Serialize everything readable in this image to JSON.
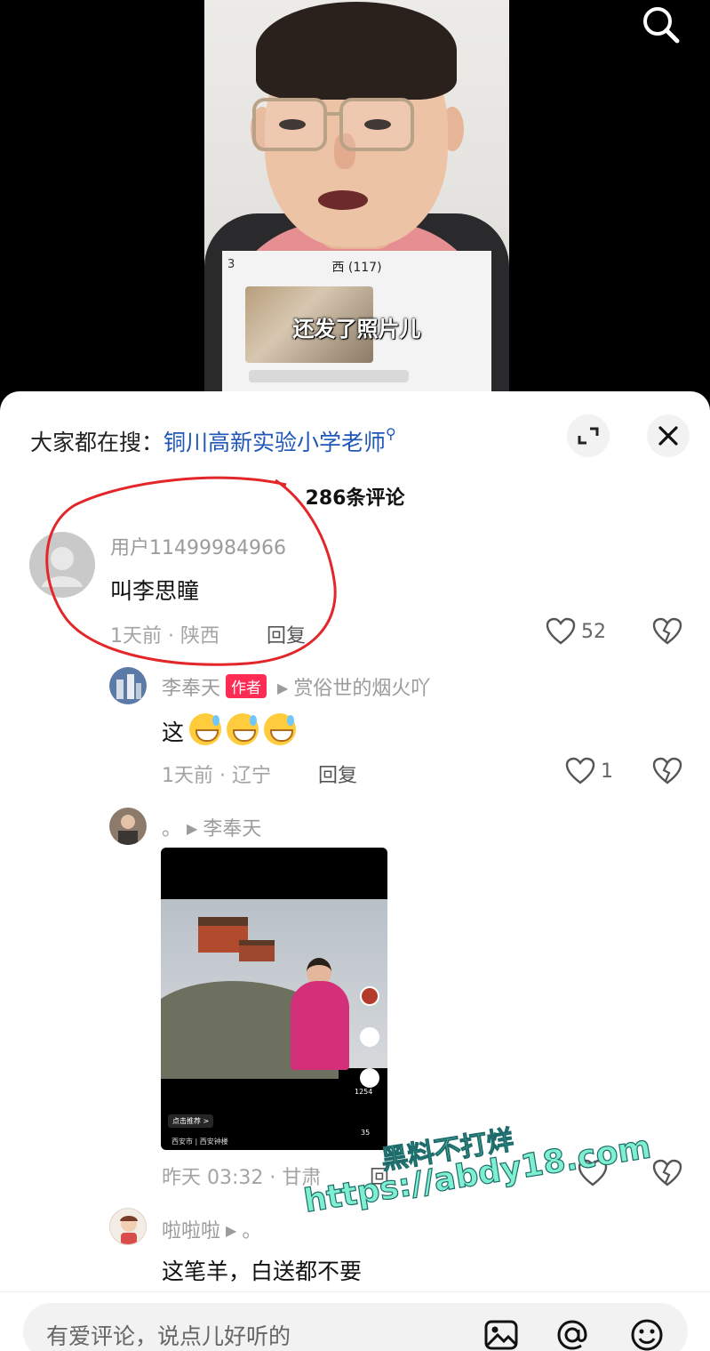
{
  "video": {
    "caption": "还发了照片儿",
    "chat_title": "西 (117)",
    "chat_number": "3"
  },
  "sheet": {
    "trending_prefix": "大家都在搜：",
    "trending_keyword": "铜川高新实验小学老师",
    "comment_count": "286条评论"
  },
  "comments": [
    {
      "username": "用户11499984966",
      "text": "叫李思瞳",
      "time_location": "1天前 · 陕西",
      "reply_label": "回复",
      "likes": "52"
    },
    {
      "username": "李奉天",
      "badge": "作者",
      "reply_to": "赏俗世的烟火吖",
      "text": "这",
      "time_location": "1天前 · 辽宁",
      "reply_label": "回复",
      "likes": "1"
    },
    {
      "username": "。",
      "reply_to": "李奉天",
      "time_location": "昨天 03:32 · 甘肃",
      "reply_label": "回",
      "video_tag": "点击推荐 >",
      "video_location": "西安市 | 西安钟楼",
      "video_stats": [
        "1254",
        "35"
      ]
    },
    {
      "username": "啦啦啦",
      "reply_to": "。",
      "text": "这笔羊，白送都不要"
    }
  ],
  "input": {
    "placeholder": "有爱评论，说点儿好听的"
  },
  "watermark": {
    "line1": "黑料不打烊",
    "line2": "https://abdy18.com"
  },
  "colors": {
    "accent_link": "#1f57b8",
    "author_badge": "#fe2c55",
    "annotation": "#e3262a",
    "watermark": "#7ff0cf"
  }
}
